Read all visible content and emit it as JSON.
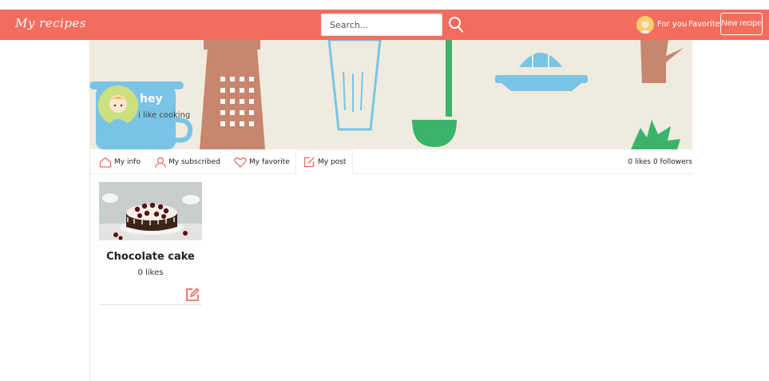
{
  "header": {
    "logo": "My recipes",
    "search_placeholder": "Search...",
    "nav": {
      "for_you": "For you",
      "favorite": "Favorite",
      "new_recipe": "New recipe"
    }
  },
  "profile": {
    "name": "hey",
    "bio": "i like cooking"
  },
  "tabs": [
    {
      "label": "My info",
      "icon": "home-icon"
    },
    {
      "label": "My subscribed",
      "icon": "user-icon"
    },
    {
      "label": "My favorite",
      "icon": "heart-icon"
    },
    {
      "label": "My post",
      "icon": "edit-icon",
      "active": true
    }
  ],
  "stats": "0 likes  0 followers",
  "posts": [
    {
      "title": "Chocolate cake",
      "likes": "0 likes"
    }
  ],
  "colors": {
    "accent": "#f26d5e",
    "banner_bg": "#efebdf"
  }
}
